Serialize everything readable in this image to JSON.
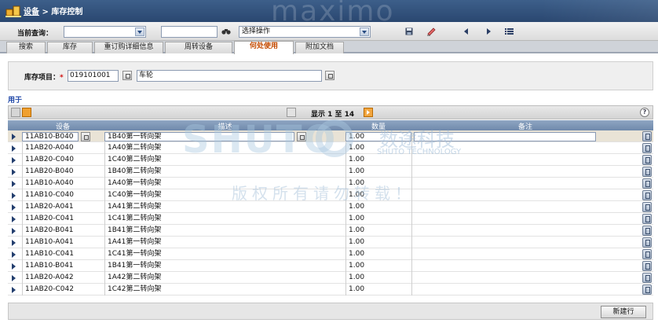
{
  "header": {
    "crumb_link": "设备",
    "crumb_sep": " > ",
    "crumb_current": "库存控制",
    "brand": "maximo"
  },
  "toolbar": {
    "query_label": "当前查询：",
    "query_value": "",
    "search_value": "",
    "action_select": "选择操作"
  },
  "tabs": [
    {
      "label": "搜索"
    },
    {
      "label": "库存"
    },
    {
      "label": "重订购详细信息"
    },
    {
      "label": "周转设备"
    },
    {
      "label": "何处使用"
    },
    {
      "label": "附加文档"
    }
  ],
  "active_tab": 4,
  "form": {
    "item_label": "库存项目：",
    "required_mark": "*",
    "item_value": "019101001",
    "desc_value": "车轮"
  },
  "used_in": {
    "title": "用于",
    "pager_text": "显示 1 至 14",
    "help": "?",
    "columns": [
      "设备",
      "描述",
      "数量",
      "备注"
    ],
    "rows": [
      {
        "asset": "11AB10-B040",
        "desc": "1B40第一转向架",
        "qty": "1.00",
        "note": ""
      },
      {
        "asset": "11AB20-A040",
        "desc": "1A40第二转向架",
        "qty": "1.00",
        "note": ""
      },
      {
        "asset": "11AB20-C040",
        "desc": "1C40第二转向架",
        "qty": "1.00",
        "note": ""
      },
      {
        "asset": "11AB20-B040",
        "desc": "1B40第二转向架",
        "qty": "1.00",
        "note": ""
      },
      {
        "asset": "11AB10-A040",
        "desc": "1A40第一转向架",
        "qty": "1.00",
        "note": ""
      },
      {
        "asset": "11AB10-C040",
        "desc": "1C40第一转向架",
        "qty": "1.00",
        "note": ""
      },
      {
        "asset": "11AB20-A041",
        "desc": "1A41第二转向架",
        "qty": "1.00",
        "note": ""
      },
      {
        "asset": "11AB20-C041",
        "desc": "1C41第二转向架",
        "qty": "1.00",
        "note": ""
      },
      {
        "asset": "11AB20-B041",
        "desc": "1B41第二转向架",
        "qty": "1.00",
        "note": ""
      },
      {
        "asset": "11AB10-A041",
        "desc": "1A41第一转向架",
        "qty": "1.00",
        "note": ""
      },
      {
        "asset": "11AB10-C041",
        "desc": "1C41第一转向架",
        "qty": "1.00",
        "note": ""
      },
      {
        "asset": "11AB10-B041",
        "desc": "1B41第一转向架",
        "qty": "1.00",
        "note": ""
      },
      {
        "asset": "11AB20-A042",
        "desc": "1A42第二转向架",
        "qty": "1.00",
        "note": ""
      },
      {
        "asset": "11AB20-C042",
        "desc": "1C42第二转向架",
        "qty": "1.00",
        "note": ""
      }
    ],
    "new_row_label": "新建行"
  },
  "watermark": {
    "logo_text": "SHUTO",
    "cn_name": "数途科技",
    "en_name": "SHUTO TECHNOLOGY",
    "notice": "版权所有请勿转载！"
  },
  "colors": {
    "header_bg": "#2f4f7d",
    "active_tab_text": "#c34a00",
    "selected_row": "#e9e3d6"
  }
}
